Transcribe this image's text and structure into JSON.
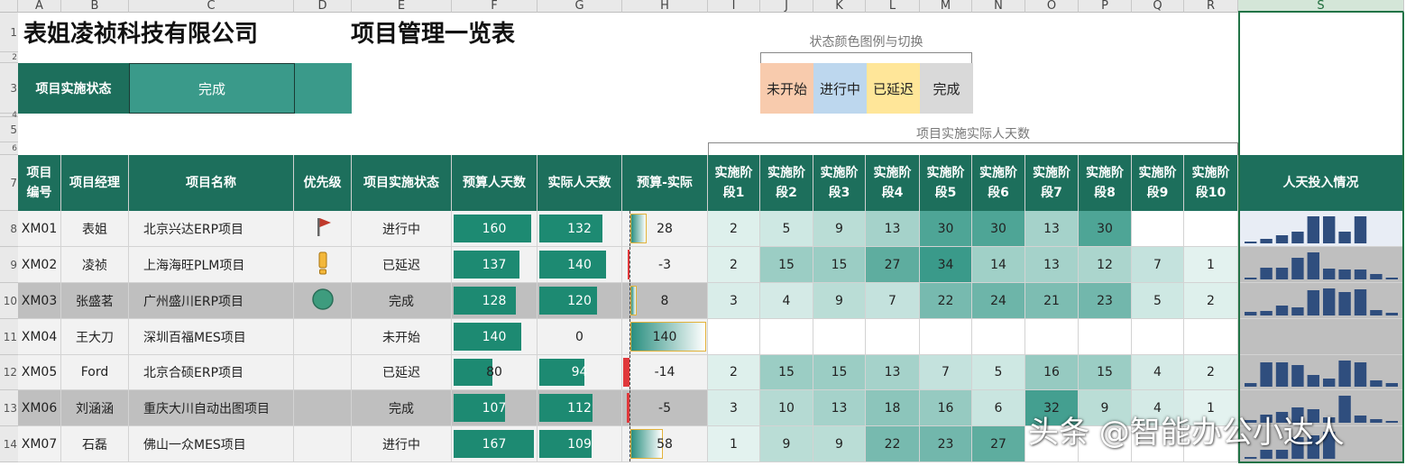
{
  "sheet": {
    "columns": [
      "A",
      "B",
      "C",
      "D",
      "E",
      "F",
      "G",
      "H",
      "I",
      "J",
      "K",
      "L",
      "M",
      "N",
      "O",
      "P",
      "Q",
      "R",
      "S"
    ],
    "selected_column": "S",
    "row_numbers": [
      "1",
      "2",
      "3",
      "4",
      "5",
      "6",
      "7",
      "8",
      "9",
      "10",
      "11",
      "12",
      "13",
      "14"
    ],
    "company": "表姐凌祯科技有限公司",
    "title": "项目管理一览表",
    "status_label": "项目实施状态",
    "status_value": "完成",
    "legend_title": "状态颜色图例与切换",
    "legend": [
      {
        "label": "未开始",
        "color": "#f8cbad"
      },
      {
        "label": "进行中",
        "color": "#bdd7ee"
      },
      {
        "label": "已延迟",
        "color": "#ffe699"
      },
      {
        "label": "完成",
        "color": "#d9d9d9"
      }
    ],
    "phase_group_label": "项目实施实际人天数",
    "headers": [
      "项目编号",
      "项目经理",
      "项目名称",
      "优先级",
      "项目实施状态",
      "预算人天数",
      "实际人天数",
      "预算-实际",
      "实施阶段1",
      "实施阶段2",
      "实施阶段3",
      "实施阶段4",
      "实施阶段5",
      "实施阶段6",
      "实施阶段7",
      "实施阶段8",
      "实施阶段9",
      "实施阶段10",
      "人天投入情况"
    ],
    "rows": [
      {
        "id": "XM01",
        "manager": "表姐",
        "name": "北京兴达ERP项目",
        "priority": "flag",
        "status": "进行中",
        "budget": 160,
        "actual": 132,
        "diff": 28,
        "phases": [
          2,
          5,
          9,
          13,
          30,
          30,
          13,
          30,
          null,
          null
        ],
        "highlight": false
      },
      {
        "id": "XM02",
        "manager": "凌祯",
        "name": "上海海旺PLM项目",
        "priority": "exclamation",
        "status": "已延迟",
        "budget": 137,
        "actual": 140,
        "diff": -3,
        "phases": [
          2,
          15,
          15,
          27,
          34,
          14,
          13,
          12,
          7,
          1
        ],
        "highlight": false
      },
      {
        "id": "XM03",
        "manager": "张盛茗",
        "name": "广州盛川ERP项目",
        "priority": "circle",
        "status": "完成",
        "budget": 128,
        "actual": 120,
        "diff": 8,
        "phases": [
          3,
          4,
          9,
          7,
          22,
          24,
          21,
          23,
          5,
          2
        ],
        "highlight": true
      },
      {
        "id": "XM04",
        "manager": "王大刀",
        "name": "深圳百福MES项目",
        "priority": "",
        "status": "未开始",
        "budget": 140,
        "actual": 0,
        "diff": 140,
        "phases": [
          null,
          null,
          null,
          null,
          null,
          null,
          null,
          null,
          null,
          null
        ],
        "highlight": false
      },
      {
        "id": "XM05",
        "manager": "Ford",
        "name": "北京合硕ERP项目",
        "priority": "",
        "status": "已延迟",
        "budget": 80,
        "actual": 94,
        "diff": -14,
        "phases": [
          2,
          15,
          15,
          13,
          7,
          5,
          16,
          15,
          4,
          2
        ],
        "highlight": false
      },
      {
        "id": "XM06",
        "manager": "刘涵涵",
        "name": "重庆大川自动出图项目",
        "priority": "",
        "status": "完成",
        "budget": 107,
        "actual": 112,
        "diff": -5,
        "phases": [
          3,
          10,
          13,
          18,
          16,
          6,
          32,
          9,
          4,
          1
        ],
        "highlight": true
      },
      {
        "id": "XM07",
        "manager": "石磊",
        "name": "佛山一众MES项目",
        "priority": "",
        "status": "进行中",
        "budget": 167,
        "actual": 109,
        "diff": 58,
        "phases": [
          1,
          9,
          9,
          22,
          23,
          27,
          null,
          null,
          null,
          null
        ],
        "highlight": false
      }
    ],
    "watermark": "头条 @智能办公小达人",
    "colors": {
      "header_bg": "#1d6f5c",
      "bar": "#1d8a72",
      "row_grey": "#bfbfbf",
      "row_light": "#f2f2f2",
      "spark_bar": "#2f4e7e",
      "negative_bar": "#e0383b"
    }
  }
}
